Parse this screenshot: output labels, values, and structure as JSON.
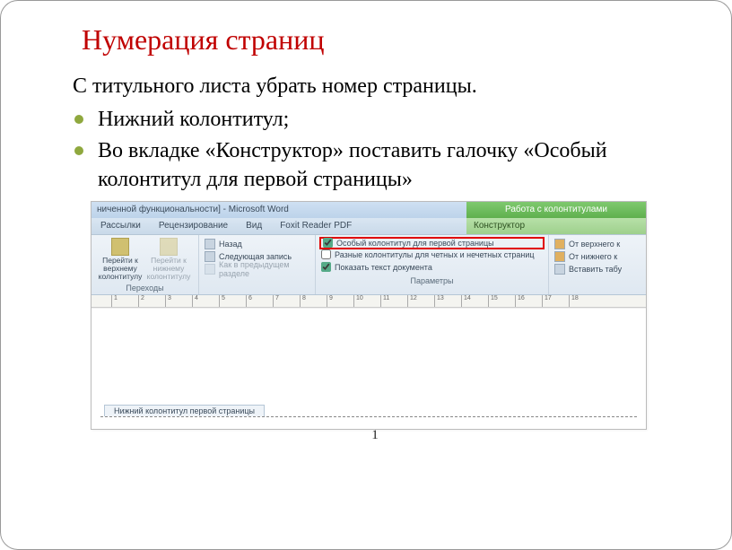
{
  "title": "Нумерация страниц",
  "intro": "С титульного листа убрать номер страницы.",
  "bullets": [
    "Нижний колонтитул;",
    "Во вкладке «Конструктор» поставить галочку «Особый колонтитул для первой страницы»"
  ],
  "word": {
    "titlebar": "ниченной функциональности] - Microsoft Word",
    "context_tab": "Работа с колонтитулами",
    "tabs": [
      "Рассылки",
      "Рецензирование",
      "Вид",
      "Foxit Reader PDF"
    ],
    "context_subtab": "Конструктор",
    "nav": {
      "prev_header": "Перейти к верхнему колонтитулу",
      "prev_footer": "Перейти к нижнему колонтитулу",
      "group": "Переходы",
      "back": "Назад",
      "next": "Следующая запись",
      "link": "Как в предыдущем разделе"
    },
    "options": {
      "first_page": "Особый колонтитул для первой страницы",
      "odd_even": "Разные колонтитулы для четных и нечетных страниц",
      "show_text": "Показать текст документа",
      "group": "Параметры"
    },
    "position": {
      "from_top": "От верхнего к",
      "from_bottom": "От нижнего к",
      "insert_tab": "Вставить табу"
    },
    "footer_label": "Нижний колонтитул первой страницы",
    "ruler": [
      "1",
      "2",
      "3",
      "4",
      "5",
      "6",
      "7",
      "8",
      "9",
      "10",
      "11",
      "12",
      "13",
      "14",
      "15",
      "16",
      "17",
      "18"
    ]
  },
  "page_number": "1"
}
